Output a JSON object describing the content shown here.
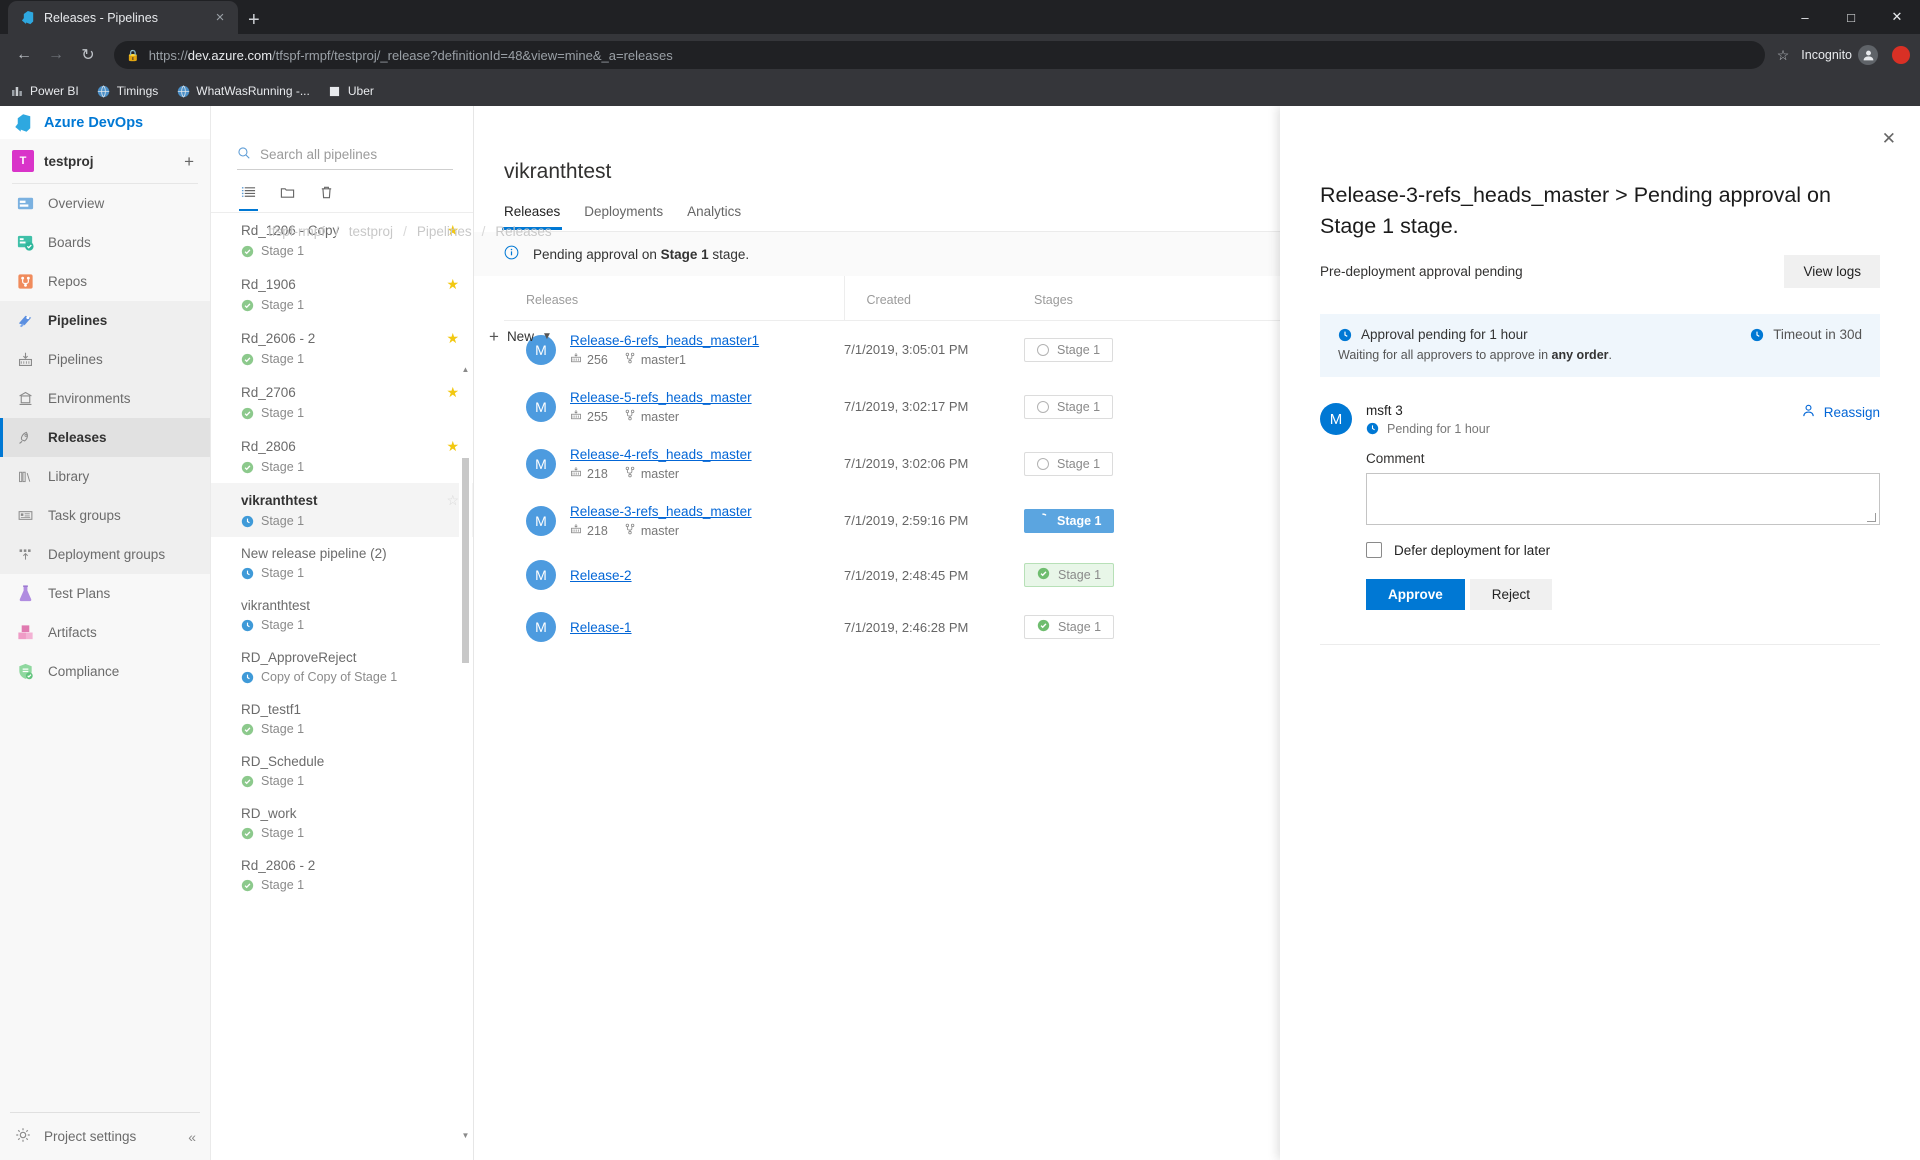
{
  "browser": {
    "tab": {
      "title": "Releases - Pipelines",
      "favicon": "azure-devops-icon",
      "close": "×"
    },
    "new_tab": "+",
    "window_controls": {
      "minimize": "–",
      "maximize": "□",
      "close": "✕"
    },
    "nav": {
      "back": "←",
      "forward": "→",
      "reload": "↻"
    },
    "omnibox": {
      "lock": "lock-icon",
      "url_scheme": "https://",
      "url_host": "dev.azure.com",
      "url_path": "/tfspf-rmpf/testproj/_release?definitionId=48&view=mine&_a=releases",
      "star": "☆"
    },
    "incognito_label": "Incognito",
    "bookmarks": [
      {
        "label": "Power BI",
        "icon": "powerbi-icon"
      },
      {
        "label": "Timings",
        "icon": "globe-icon"
      },
      {
        "label": "WhatWasRunning -...",
        "icon": "globe-icon"
      },
      {
        "label": "Uber",
        "icon": "square-icon"
      }
    ]
  },
  "sidebar": {
    "brand": "Azure DevOps",
    "project": {
      "initial": "T",
      "name": "testproj",
      "add": "+"
    },
    "items": [
      {
        "label": "Overview",
        "icon": "overview-icon"
      },
      {
        "label": "Boards",
        "icon": "boards-icon"
      },
      {
        "label": "Repos",
        "icon": "repos-icon"
      },
      {
        "label": "Pipelines",
        "icon": "pipelines-icon"
      }
    ],
    "sub_items": [
      {
        "label": "Pipelines",
        "icon": "pipelines-sub-icon"
      },
      {
        "label": "Environments",
        "icon": "environments-icon"
      },
      {
        "label": "Releases",
        "icon": "releases-icon"
      },
      {
        "label": "Library",
        "icon": "library-icon"
      },
      {
        "label": "Task groups",
        "icon": "task-groups-icon"
      },
      {
        "label": "Deployment groups",
        "icon": "deployment-groups-icon"
      }
    ],
    "tail_items": [
      {
        "label": "Test Plans",
        "icon": "test-plans-icon"
      },
      {
        "label": "Artifacts",
        "icon": "artifacts-icon"
      },
      {
        "label": "Compliance",
        "icon": "compliance-icon"
      }
    ],
    "project_settings": "Project settings",
    "collapse": "«"
  },
  "pipelines_panel": {
    "search_placeholder": "Search all pipelines",
    "search_value": "",
    "toolbar": [
      {
        "name": "all-pipelines-view",
        "icon": "list-icon"
      },
      {
        "name": "folders-view",
        "icon": "folder-icon"
      },
      {
        "name": "recycle-bin",
        "icon": "trash-icon"
      }
    ],
    "new_button": "New",
    "items": [
      {
        "name": "Rd_1206 - Copy",
        "stage": "Stage 1",
        "status": "succeeded",
        "starred": true,
        "selected": false
      },
      {
        "name": "Rd_1906",
        "stage": "Stage 1",
        "status": "succeeded",
        "starred": true,
        "selected": false
      },
      {
        "name": "Rd_2606 - 2",
        "stage": "Stage 1",
        "status": "succeeded",
        "starred": true,
        "selected": false
      },
      {
        "name": "Rd_2706",
        "stage": "Stage 1",
        "status": "succeeded",
        "starred": true,
        "selected": false
      },
      {
        "name": "Rd_2806",
        "stage": "Stage 1",
        "status": "succeeded",
        "starred": true,
        "selected": false
      },
      {
        "name": "vikranthtest",
        "stage": "Stage 1",
        "status": "pending",
        "starred": false,
        "selected": true
      },
      {
        "name": "New release pipeline (2)",
        "stage": "Stage 1",
        "status": "pending",
        "starred": false,
        "selected": false
      },
      {
        "name": "vikranthtest",
        "stage": "Stage 1",
        "status": "pending",
        "starred": false,
        "selected": false
      },
      {
        "name": "RD_ApproveReject",
        "stage": "Copy of Copy of Stage 1",
        "status": "pending",
        "starred": false,
        "selected": false
      },
      {
        "name": "RD_testf1",
        "stage": "Stage 1",
        "status": "succeeded",
        "starred": false,
        "selected": false
      },
      {
        "name": "RD_Schedule",
        "stage": "Stage 1",
        "status": "succeeded",
        "starred": false,
        "selected": false
      },
      {
        "name": "RD_work",
        "stage": "Stage 1",
        "status": "succeeded",
        "starred": false,
        "selected": false
      },
      {
        "name": "Rd_2806 - 2",
        "stage": "Stage 1",
        "status": "succeeded",
        "starred": false,
        "selected": false
      }
    ]
  },
  "breadcrumb": [
    "tfspf-rmpf",
    "testproj",
    "Pipelines",
    "Releases"
  ],
  "main": {
    "title": "vikranthtest",
    "tabs": [
      {
        "label": "Releases",
        "active": true
      },
      {
        "label": "Deployments",
        "active": false
      },
      {
        "label": "Analytics",
        "active": false
      }
    ],
    "info_banner": {
      "icon": "info-icon",
      "prefix": "Pending approval on ",
      "bold": "Stage 1",
      "suffix": " stage."
    },
    "table": {
      "columns": [
        "Releases",
        "Created",
        "Stages"
      ],
      "rows": [
        {
          "avatar": "M",
          "name": "Release-6-refs_heads_master1",
          "build": "256",
          "branch": "master1",
          "created": "7/1/2019, 3:05:01 PM",
          "stage": "Stage 1",
          "stage_state": "not-deployed"
        },
        {
          "avatar": "M",
          "name": "Release-5-refs_heads_master",
          "build": "255",
          "branch": "master",
          "created": "7/1/2019, 3:02:17 PM",
          "stage": "Stage 1",
          "stage_state": "not-deployed"
        },
        {
          "avatar": "M",
          "name": "Release-4-refs_heads_master",
          "build": "218",
          "branch": "master",
          "created": "7/1/2019, 3:02:06 PM",
          "stage": "Stage 1",
          "stage_state": "not-deployed"
        },
        {
          "avatar": "M",
          "name": "Release-3-refs_heads_master",
          "build": "218",
          "branch": "master",
          "created": "7/1/2019, 2:59:16 PM",
          "stage": "Stage 1",
          "stage_state": "in-progress"
        },
        {
          "avatar": "M",
          "name": "Release-2",
          "build": "",
          "branch": "",
          "created": "7/1/2019, 2:48:45 PM",
          "stage": "Stage 1",
          "stage_state": "succeeded-highlight"
        },
        {
          "avatar": "M",
          "name": "Release-1",
          "build": "",
          "branch": "",
          "created": "7/1/2019, 2:46:28 PM",
          "stage": "Stage 1",
          "stage_state": "succeeded"
        }
      ]
    }
  },
  "flyout": {
    "close": "✕",
    "title": "Release-3-refs_heads_master > Pending approval on Stage 1 stage.",
    "subtitle": "Pre-deployment approval pending",
    "view_logs": "View logs",
    "pending": {
      "status": "Approval pending for 1 hour",
      "timeout": "Timeout in 30d",
      "note_prefix": "Waiting for all approvers to approve in ",
      "note_bold": "any order",
      "note_suffix": "."
    },
    "approver": {
      "avatar": "M",
      "name": "msft 3",
      "status": "Pending for 1 hour",
      "reassign": "Reassign"
    },
    "comment_label": "Comment",
    "comment_value": "",
    "defer_label": "Defer deployment for later",
    "defer_checked": false,
    "approve": "Approve",
    "reject": "Reject"
  },
  "colors": {
    "accent": "#0078d4",
    "link": "#0366d6",
    "success": "#6bb700",
    "in_progress": "#5ba5e0",
    "info_bg": "#eff6fc"
  }
}
